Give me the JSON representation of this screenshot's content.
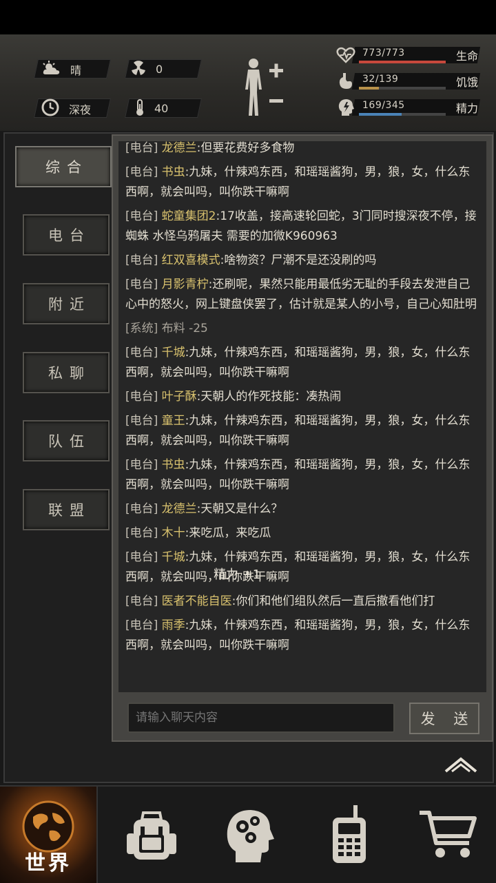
{
  "status": {
    "weather": "晴",
    "radiation": "0",
    "time_of_day": "深夜",
    "temperature": "40",
    "stats": [
      {
        "value": "773/773",
        "label": "生命",
        "fraction": 1.0,
        "color": "#c7483c",
        "icon": "heart-pulse-icon"
      },
      {
        "value": "32/139",
        "label": "饥饿",
        "fraction": 0.23,
        "color": "#b8924a",
        "icon": "stomach-icon"
      },
      {
        "value": "169/345",
        "label": "精力",
        "fraction": 0.49,
        "color": "#4a83b8",
        "icon": "energy-head-icon"
      }
    ]
  },
  "tabs": [
    {
      "label": "综合",
      "active": true
    },
    {
      "label": "电台",
      "active": false
    },
    {
      "label": "附近",
      "active": false
    },
    {
      "label": "私聊",
      "active": false
    },
    {
      "label": "队伍",
      "active": false
    },
    {
      "label": "联盟",
      "active": false
    }
  ],
  "messages": [
    {
      "tag": "[电台]",
      "name": "龙德兰",
      "text": ":但要花费好多食物"
    },
    {
      "tag": "[电台]",
      "name": "书虫",
      "text": ":九妹，什辣鸡东西，和瑶瑶酱狗，男，狼，女，什么东西啊，就会叫吗，叫你跌干嘛啊"
    },
    {
      "tag": "[电台]",
      "name": "蛇童集团2",
      "text": ":17收盖，接高速轮回蛇，3门同时搜深夜不停，接蜘蛛 水怪乌鸦屠夫 需要的加微K960963"
    },
    {
      "tag": "[电台]",
      "name": "红双喜模式",
      "text": ":啥物资？尸潮不是还没刷的吗"
    },
    {
      "tag": "[电台]",
      "name": "月影青柠",
      "text": ":还刷呢，果然只能用最低劣无耻的手段去发泄自己心中的怒火，网上键盘侠罢了，估计就是某人的小号，自己心知肚明"
    },
    {
      "tag": "[系统]",
      "name": "",
      "text": "布料 -25",
      "system": true
    },
    {
      "tag": "[电台]",
      "name": "千城",
      "text": ":九妹，什辣鸡东西，和瑶瑶酱狗，男，狼，女，什么东西啊，就会叫吗，叫你跌干嘛啊"
    },
    {
      "tag": "[电台]",
      "name": "叶子酥",
      "text": ":天朝人的作死技能：凑热闹"
    },
    {
      "tag": "[电台]",
      "name": "童王",
      "text": ":九妹，什辣鸡东西，和瑶瑶酱狗，男，狼，女，什么东西啊，就会叫吗，叫你跌干嘛啊"
    },
    {
      "tag": "[电台]",
      "name": "书虫",
      "text": ":九妹，什辣鸡东西，和瑶瑶酱狗，男，狼，女，什么东西啊，就会叫吗，叫你跌干嘛啊"
    },
    {
      "tag": "[电台]",
      "name": "龙德兰",
      "text": ":天朝又是什么？"
    },
    {
      "tag": "[电台]",
      "name": "木十",
      "text": ":来吃瓜，来吃瓜"
    },
    {
      "tag": "[电台]",
      "name": "千城",
      "text": ":九妹，什辣鸡东西，和瑶瑶酱狗，男，狼，女，什么东西啊，就会叫吗，叫你跌干嘛啊"
    },
    {
      "tag": "[电台]",
      "name": "医者不能自医",
      "text": ":你们和他们组队然后一直后撤看他们打"
    },
    {
      "tag": "[电台]",
      "name": "雨季",
      "text": ":九妹，什辣鸡东西，和瑶瑶酱狗，男，狼，女，什么东西啊，就会叫吗，叫你跌干嘛啊"
    }
  ],
  "floating_notice": "精力 +1",
  "chat_input": {
    "placeholder": "请输入聊天内容",
    "value": ""
  },
  "send_label": "发 送",
  "nav": {
    "world_label": "世界",
    "items": [
      "world-globe-icon",
      "backpack-icon",
      "skills-head-icon",
      "walkie-talkie-icon",
      "shopping-cart-icon"
    ]
  }
}
